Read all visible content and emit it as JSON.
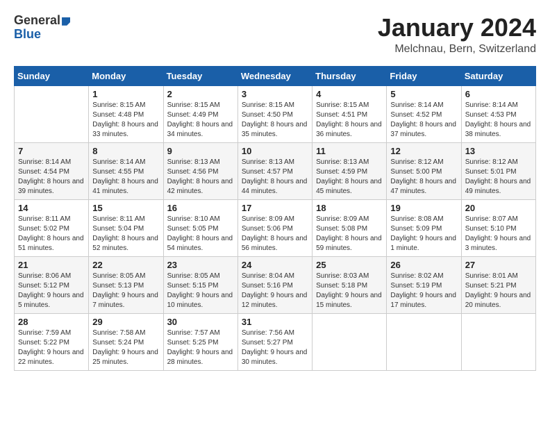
{
  "header": {
    "logo_general": "General",
    "logo_blue": "Blue",
    "month_title": "January 2024",
    "location": "Melchnau, Bern, Switzerland"
  },
  "days_of_week": [
    "Sunday",
    "Monday",
    "Tuesday",
    "Wednesday",
    "Thursday",
    "Friday",
    "Saturday"
  ],
  "weeks": [
    [
      {
        "day": "",
        "sunrise": "",
        "sunset": "",
        "daylight": ""
      },
      {
        "day": "1",
        "sunrise": "Sunrise: 8:15 AM",
        "sunset": "Sunset: 4:48 PM",
        "daylight": "Daylight: 8 hours and 33 minutes."
      },
      {
        "day": "2",
        "sunrise": "Sunrise: 8:15 AM",
        "sunset": "Sunset: 4:49 PM",
        "daylight": "Daylight: 8 hours and 34 minutes."
      },
      {
        "day": "3",
        "sunrise": "Sunrise: 8:15 AM",
        "sunset": "Sunset: 4:50 PM",
        "daylight": "Daylight: 8 hours and 35 minutes."
      },
      {
        "day": "4",
        "sunrise": "Sunrise: 8:15 AM",
        "sunset": "Sunset: 4:51 PM",
        "daylight": "Daylight: 8 hours and 36 minutes."
      },
      {
        "day": "5",
        "sunrise": "Sunrise: 8:14 AM",
        "sunset": "Sunset: 4:52 PM",
        "daylight": "Daylight: 8 hours and 37 minutes."
      },
      {
        "day": "6",
        "sunrise": "Sunrise: 8:14 AM",
        "sunset": "Sunset: 4:53 PM",
        "daylight": "Daylight: 8 hours and 38 minutes."
      }
    ],
    [
      {
        "day": "7",
        "sunrise": "Sunrise: 8:14 AM",
        "sunset": "Sunset: 4:54 PM",
        "daylight": "Daylight: 8 hours and 39 minutes."
      },
      {
        "day": "8",
        "sunrise": "Sunrise: 8:14 AM",
        "sunset": "Sunset: 4:55 PM",
        "daylight": "Daylight: 8 hours and 41 minutes."
      },
      {
        "day": "9",
        "sunrise": "Sunrise: 8:13 AM",
        "sunset": "Sunset: 4:56 PM",
        "daylight": "Daylight: 8 hours and 42 minutes."
      },
      {
        "day": "10",
        "sunrise": "Sunrise: 8:13 AM",
        "sunset": "Sunset: 4:57 PM",
        "daylight": "Daylight: 8 hours and 44 minutes."
      },
      {
        "day": "11",
        "sunrise": "Sunrise: 8:13 AM",
        "sunset": "Sunset: 4:59 PM",
        "daylight": "Daylight: 8 hours and 45 minutes."
      },
      {
        "day": "12",
        "sunrise": "Sunrise: 8:12 AM",
        "sunset": "Sunset: 5:00 PM",
        "daylight": "Daylight: 8 hours and 47 minutes."
      },
      {
        "day": "13",
        "sunrise": "Sunrise: 8:12 AM",
        "sunset": "Sunset: 5:01 PM",
        "daylight": "Daylight: 8 hours and 49 minutes."
      }
    ],
    [
      {
        "day": "14",
        "sunrise": "Sunrise: 8:11 AM",
        "sunset": "Sunset: 5:02 PM",
        "daylight": "Daylight: 8 hours and 51 minutes."
      },
      {
        "day": "15",
        "sunrise": "Sunrise: 8:11 AM",
        "sunset": "Sunset: 5:04 PM",
        "daylight": "Daylight: 8 hours and 52 minutes."
      },
      {
        "day": "16",
        "sunrise": "Sunrise: 8:10 AM",
        "sunset": "Sunset: 5:05 PM",
        "daylight": "Daylight: 8 hours and 54 minutes."
      },
      {
        "day": "17",
        "sunrise": "Sunrise: 8:09 AM",
        "sunset": "Sunset: 5:06 PM",
        "daylight": "Daylight: 8 hours and 56 minutes."
      },
      {
        "day": "18",
        "sunrise": "Sunrise: 8:09 AM",
        "sunset": "Sunset: 5:08 PM",
        "daylight": "Daylight: 8 hours and 59 minutes."
      },
      {
        "day": "19",
        "sunrise": "Sunrise: 8:08 AM",
        "sunset": "Sunset: 5:09 PM",
        "daylight": "Daylight: 9 hours and 1 minute."
      },
      {
        "day": "20",
        "sunrise": "Sunrise: 8:07 AM",
        "sunset": "Sunset: 5:10 PM",
        "daylight": "Daylight: 9 hours and 3 minutes."
      }
    ],
    [
      {
        "day": "21",
        "sunrise": "Sunrise: 8:06 AM",
        "sunset": "Sunset: 5:12 PM",
        "daylight": "Daylight: 9 hours and 5 minutes."
      },
      {
        "day": "22",
        "sunrise": "Sunrise: 8:05 AM",
        "sunset": "Sunset: 5:13 PM",
        "daylight": "Daylight: 9 hours and 7 minutes."
      },
      {
        "day": "23",
        "sunrise": "Sunrise: 8:05 AM",
        "sunset": "Sunset: 5:15 PM",
        "daylight": "Daylight: 9 hours and 10 minutes."
      },
      {
        "day": "24",
        "sunrise": "Sunrise: 8:04 AM",
        "sunset": "Sunset: 5:16 PM",
        "daylight": "Daylight: 9 hours and 12 minutes."
      },
      {
        "day": "25",
        "sunrise": "Sunrise: 8:03 AM",
        "sunset": "Sunset: 5:18 PM",
        "daylight": "Daylight: 9 hours and 15 minutes."
      },
      {
        "day": "26",
        "sunrise": "Sunrise: 8:02 AM",
        "sunset": "Sunset: 5:19 PM",
        "daylight": "Daylight: 9 hours and 17 minutes."
      },
      {
        "day": "27",
        "sunrise": "Sunrise: 8:01 AM",
        "sunset": "Sunset: 5:21 PM",
        "daylight": "Daylight: 9 hours and 20 minutes."
      }
    ],
    [
      {
        "day": "28",
        "sunrise": "Sunrise: 7:59 AM",
        "sunset": "Sunset: 5:22 PM",
        "daylight": "Daylight: 9 hours and 22 minutes."
      },
      {
        "day": "29",
        "sunrise": "Sunrise: 7:58 AM",
        "sunset": "Sunset: 5:24 PM",
        "daylight": "Daylight: 9 hours and 25 minutes."
      },
      {
        "day": "30",
        "sunrise": "Sunrise: 7:57 AM",
        "sunset": "Sunset: 5:25 PM",
        "daylight": "Daylight: 9 hours and 28 minutes."
      },
      {
        "day": "31",
        "sunrise": "Sunrise: 7:56 AM",
        "sunset": "Sunset: 5:27 PM",
        "daylight": "Daylight: 9 hours and 30 minutes."
      },
      {
        "day": "",
        "sunrise": "",
        "sunset": "",
        "daylight": ""
      },
      {
        "day": "",
        "sunrise": "",
        "sunset": "",
        "daylight": ""
      },
      {
        "day": "",
        "sunrise": "",
        "sunset": "",
        "daylight": ""
      }
    ]
  ]
}
